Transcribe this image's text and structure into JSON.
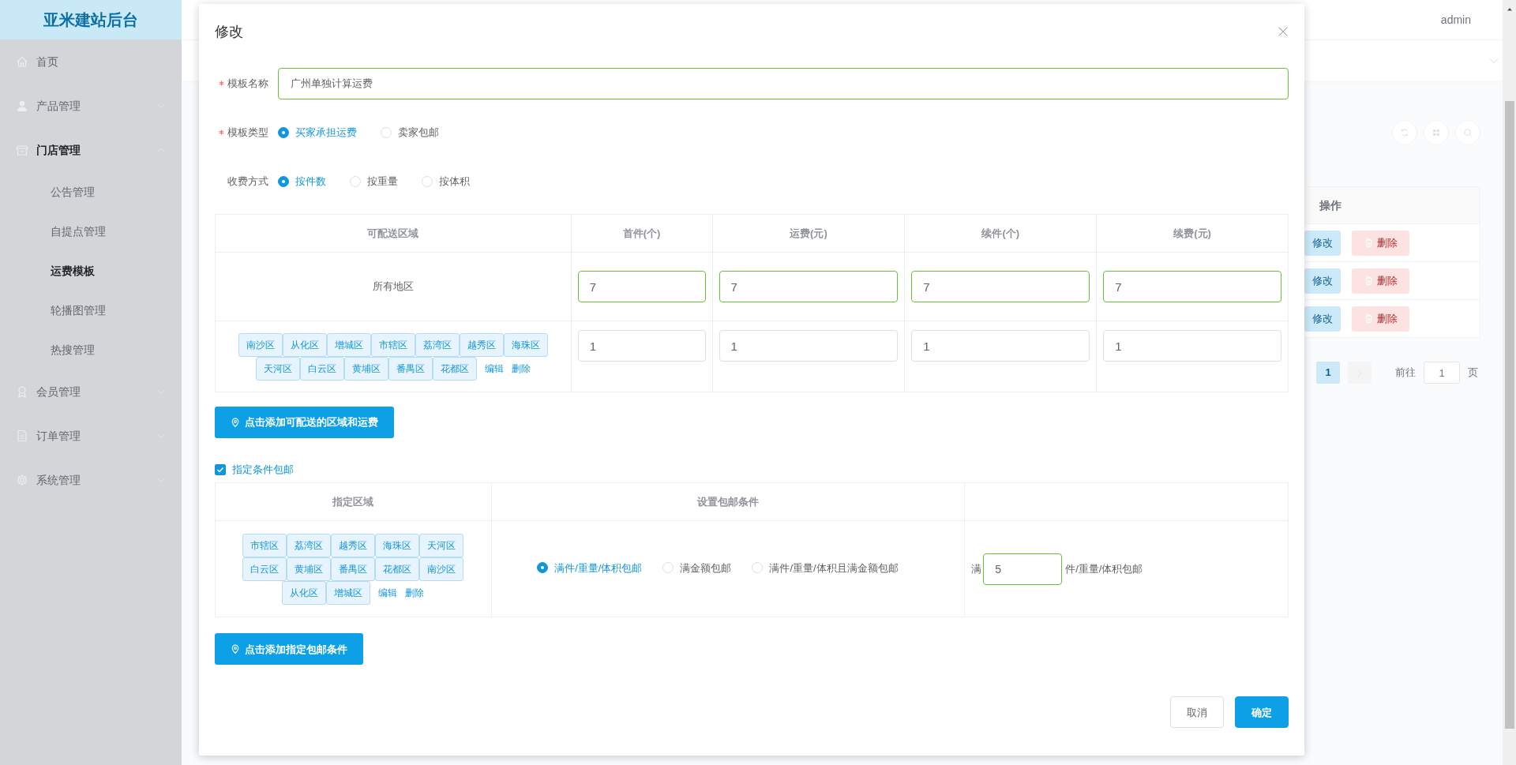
{
  "sidebar": {
    "title": "亚米建站后台",
    "items": [
      {
        "kind": "link",
        "label": "首页",
        "selected": false
      },
      {
        "kind": "group",
        "label": "产品管理",
        "selected": false,
        "expanded": false
      },
      {
        "kind": "group",
        "label": "门店管理",
        "selected": true,
        "expanded": true,
        "children": [
          {
            "label": "公告管理",
            "selected": false
          },
          {
            "label": "自提点管理",
            "selected": false
          },
          {
            "label": "运费模板",
            "selected": true
          },
          {
            "label": "轮播图管理",
            "selected": false
          },
          {
            "label": "热搜管理",
            "selected": false
          }
        ]
      },
      {
        "kind": "group",
        "label": "会员管理",
        "selected": false,
        "expanded": false
      },
      {
        "kind": "group",
        "label": "订单管理",
        "selected": false,
        "expanded": false
      },
      {
        "kind": "group",
        "label": "系统管理",
        "selected": false,
        "expanded": false
      }
    ]
  },
  "header": {
    "user": "admin"
  },
  "table": {
    "columns": [
      "操作"
    ],
    "rows": [
      {
        "edit": "修改",
        "delete": "删除"
      },
      {
        "edit": "修改",
        "delete": "删除"
      },
      {
        "edit": "修改",
        "delete": "删除"
      }
    ]
  },
  "pagination": {
    "pages": [
      {
        "label": "1",
        "selected": true
      }
    ],
    "goto_label": "前往",
    "goto_value": "1",
    "page_suffix": "页"
  },
  "modal": {
    "title": "修改",
    "fields": [
      {
        "kind": "text",
        "label": "模板名称",
        "required": true,
        "value": "广州单独计算运费"
      },
      {
        "kind": "radio",
        "label": "模板类型",
        "required": true,
        "options": [
          {
            "label": "买家承担运费",
            "selected": true
          },
          {
            "label": "卖家包邮",
            "selected": false
          }
        ]
      },
      {
        "kind": "radio",
        "label": "收费方式",
        "required": false,
        "options": [
          {
            "label": "按件数",
            "selected": true
          },
          {
            "label": "按重量",
            "selected": false
          },
          {
            "label": "按体积",
            "selected": false
          }
        ]
      }
    ],
    "shipping_table": {
      "columns": [
        "可配送区域",
        "首件(个)",
        "运费(元)",
        "续件(个)",
        "续费(元)"
      ],
      "rows": [
        {
          "area_text": "所有地区",
          "values": [
            {
              "value": "7",
              "validated": true
            },
            {
              "value": "7",
              "validated": true
            },
            {
              "value": "7",
              "validated": true
            },
            {
              "value": "7",
              "validated": true
            }
          ]
        },
        {
          "regions": [
            "南沙区",
            "从化区",
            "增城区",
            "市辖区",
            "荔湾区",
            "越秀区",
            "海珠区",
            "天河区",
            "白云区",
            "黄埔区",
            "番禺区",
            "花都区"
          ],
          "actions": [
            "编辑",
            "删除"
          ],
          "values": [
            {
              "value": "1",
              "validated": false
            },
            {
              "value": "1",
              "validated": false
            },
            {
              "value": "1",
              "validated": false
            },
            {
              "value": "1",
              "validated": false
            }
          ]
        }
      ]
    },
    "add_region_button": "点击添加可配送的区域和运费",
    "free_shipping": {
      "label": "指定条件包邮",
      "checked": true,
      "columns": [
        "指定区域",
        "设置包邮条件"
      ],
      "rows": [
        {
          "regions": [
            "市辖区",
            "荔湾区",
            "越秀区",
            "海珠区",
            "天河区",
            "白云区",
            "黄埔区",
            "番禺区",
            "花都区",
            "南沙区",
            "从化区",
            "增城区"
          ],
          "actions": [
            "编辑",
            "删除"
          ],
          "conditions": [
            {
              "label": "满件/重量/体积包邮",
              "selected": true
            },
            {
              "label": "满金额包邮",
              "selected": false
            },
            {
              "label": "满件/重量/体积且满金额包邮",
              "selected": false
            }
          ],
          "prefix": "满",
          "value": "5",
          "validated": true,
          "suffix": "件/重量/体积包邮"
        }
      ]
    },
    "add_condition_button": "点击添加指定包邮条件",
    "buttons": [
      {
        "label": "取消",
        "kind": "default"
      },
      {
        "label": "确定",
        "kind": "primary"
      }
    ]
  }
}
